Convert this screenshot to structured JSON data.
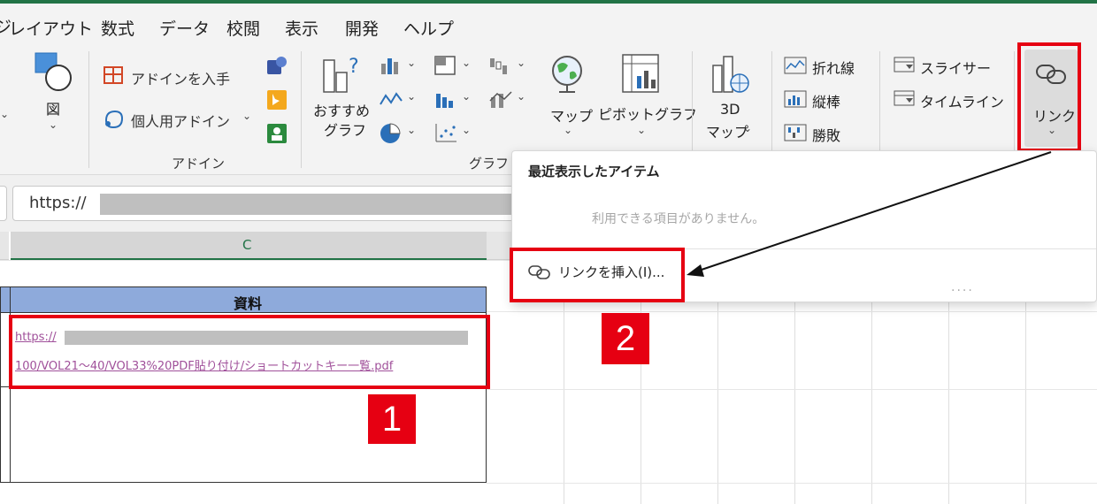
{
  "menu": [
    "レイアウト",
    "数式",
    "データ",
    "校閲",
    "表示",
    "開発",
    "ヘルプ"
  ],
  "ribbon": {
    "figure": "図",
    "addins": {
      "get": "アドインを入手",
      "personal": "個人用アドイン",
      "group": "アドイン"
    },
    "recommended": [
      "おすすめ",
      "グラフ"
    ],
    "chart_group": "グラフ",
    "map": "マップ",
    "pivot_chart": "ピボットグラフ",
    "map3d": [
      "3D",
      "マップ"
    ],
    "sparklines": [
      "折れ線",
      "縦棒",
      "勝敗"
    ],
    "slicer": "スライサー",
    "timeline": "タイムライン",
    "link": "リンク"
  },
  "formula": {
    "prefix": "https://"
  },
  "grid": {
    "column_c": "C",
    "header": "資料",
    "link_line1": "https://",
    "link_line2": "100/VOL21～40/VOL33%20PDF貼り付け/ショートカットキー一覧.pdf"
  },
  "dropdown": {
    "title": "最近表示したアイテム",
    "empty": "利用できる項目がありません。",
    "insert": "リンクを挿入(I)...",
    "dots": "...."
  },
  "badges": [
    "1",
    "2"
  ],
  "colors": {
    "excel_green": "#217346",
    "highlight_red": "#e60012",
    "header_blue": "#8eaadb",
    "link": "#a0509a"
  }
}
